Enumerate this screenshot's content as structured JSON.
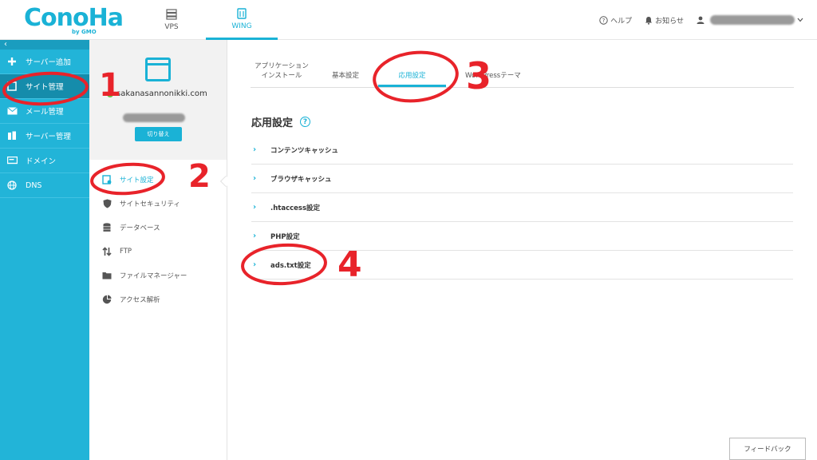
{
  "header": {
    "logo_text": "ConoHa",
    "logo_sub": "by GMO",
    "nav": [
      {
        "label": "VPS",
        "icon": "server-icon"
      },
      {
        "label": "WING",
        "icon": "building-icon",
        "active": true
      }
    ],
    "help_label": "ヘルプ",
    "notice_label": "お知らせ"
  },
  "sidebar": {
    "collapse": "‹",
    "items": [
      {
        "label": "サーバー追加",
        "icon": "plus-icon"
      },
      {
        "label": "サイト管理",
        "icon": "site-icon",
        "active": true
      },
      {
        "label": "メール管理",
        "icon": "mail-icon"
      },
      {
        "label": "サーバー管理",
        "icon": "server-manage-icon"
      },
      {
        "label": "ドメイン",
        "icon": "domain-icon"
      },
      {
        "label": "DNS",
        "icon": "globe-icon"
      }
    ]
  },
  "site": {
    "domain": "sakanasannonikki.com",
    "switch_label": "切り替え"
  },
  "subnav": {
    "items": [
      {
        "label": "サイト設定",
        "icon": "site-settings-icon",
        "active": true
      },
      {
        "label": "サイトセキュリティ",
        "icon": "shield-icon"
      },
      {
        "label": "データベース",
        "icon": "database-icon"
      },
      {
        "label": "FTP",
        "icon": "transfer-icon"
      },
      {
        "label": "ファイルマネージャー",
        "icon": "folder-icon"
      },
      {
        "label": "アクセス解析",
        "icon": "pie-chart-icon"
      }
    ]
  },
  "tabs": [
    {
      "label": "アプリケーション\nインストール"
    },
    {
      "label": "基本設定"
    },
    {
      "label": "応用設定",
      "active": true
    },
    {
      "label": "WordPressテーマ"
    }
  ],
  "main": {
    "title": "応用設定",
    "help": "?",
    "sections": [
      {
        "label": "コンテンツキャッシュ"
      },
      {
        "label": "ブラウザキャッシュ"
      },
      {
        "label": ".htaccess設定"
      },
      {
        "label": "PHP設定"
      },
      {
        "label": "ads.txt設定"
      }
    ],
    "chevron": "›",
    "feedback_label": "フィードバック"
  },
  "annotations": {
    "numbers": [
      "1",
      "2",
      "3",
      "4"
    ],
    "color": "#e8232a"
  },
  "colors": {
    "accent": "#1ab2d6",
    "sidebar_bg": "#22b4d8",
    "sidebar_active": "#158cab",
    "status_green": "#6cc04a"
  }
}
